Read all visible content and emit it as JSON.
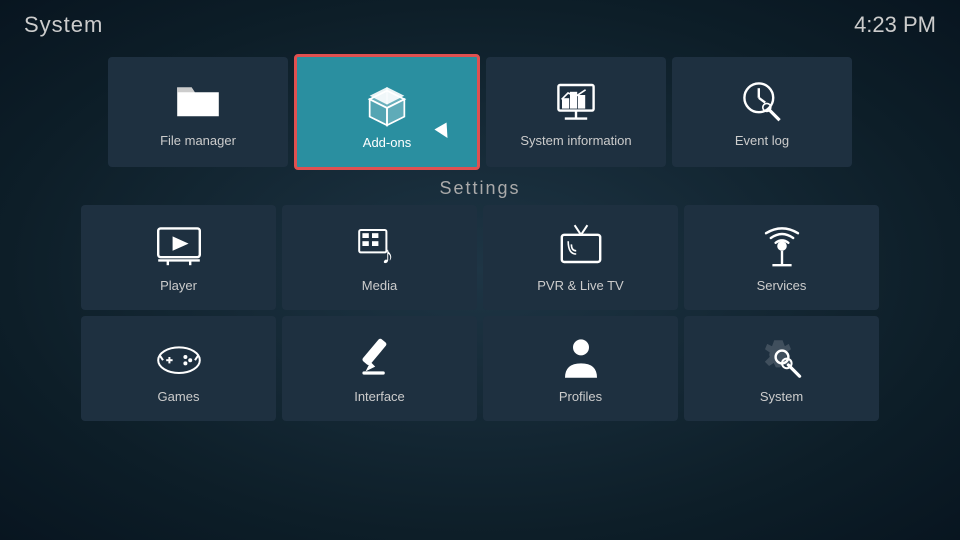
{
  "header": {
    "title": "System",
    "clock": "4:23 PM"
  },
  "top_row": [
    {
      "id": "file-manager",
      "label": "File manager",
      "icon": "folder"
    },
    {
      "id": "add-ons",
      "label": "Add-ons",
      "icon": "addons",
      "focused": true
    },
    {
      "id": "system-information",
      "label": "System information",
      "icon": "system-info"
    },
    {
      "id": "event-log",
      "label": "Event log",
      "icon": "event-log"
    }
  ],
  "settings_label": "Settings",
  "settings_row1": [
    {
      "id": "player",
      "label": "Player",
      "icon": "player"
    },
    {
      "id": "media",
      "label": "Media",
      "icon": "media"
    },
    {
      "id": "pvr-live-tv",
      "label": "PVR & Live TV",
      "icon": "pvr"
    },
    {
      "id": "services",
      "label": "Services",
      "icon": "services"
    }
  ],
  "settings_row2": [
    {
      "id": "games",
      "label": "Games",
      "icon": "games"
    },
    {
      "id": "interface",
      "label": "Interface",
      "icon": "interface"
    },
    {
      "id": "profiles",
      "label": "Profiles",
      "icon": "profiles"
    },
    {
      "id": "system",
      "label": "System",
      "icon": "system-gear"
    }
  ]
}
